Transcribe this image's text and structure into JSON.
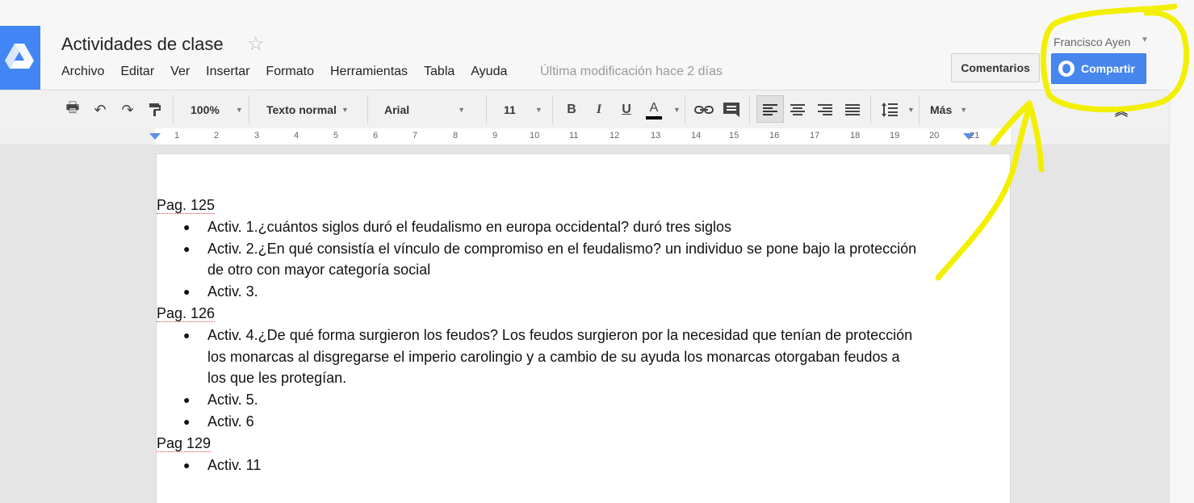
{
  "header": {
    "title": "Actividades de clase",
    "menu": [
      "Archivo",
      "Editar",
      "Ver",
      "Insertar",
      "Formato",
      "Herramientas",
      "Tabla",
      "Ayuda"
    ],
    "last_edit": "Última modificación hace 2 días",
    "user": "Francisco Ayen",
    "comments_label": "Comentarios",
    "share_label": "Compartir"
  },
  "toolbar": {
    "zoom": "100%",
    "style": "Texto normal",
    "font": "Arial",
    "size": "11",
    "bold": "B",
    "italic": "I",
    "underline": "U",
    "text_color": "A",
    "more": "Más"
  },
  "ruler": {
    "marks": [
      "1",
      "2",
      "3",
      "4",
      "5",
      "6",
      "7",
      "8",
      "9",
      "10",
      "11",
      "12",
      "13",
      "14",
      "15",
      "16",
      "17",
      "18",
      "19",
      "20",
      "21"
    ]
  },
  "document": {
    "sections": [
      {
        "heading": "Pag. 125",
        "items": [
          "Activ. 1.¿cuántos siglos duró el feudalismo en europa occidental? duró tres siglos",
          "Activ. 2.¿En qué consistía el vínculo de compromiso en el feudalismo? un individuo se pone bajo la protección de otro con mayor categoría social",
          "Activ. 3."
        ]
      },
      {
        "heading": "Pag. 126",
        "items": [
          "Activ. 4.¿De qué forma surgieron los feudos? Los feudos surgieron por la necesidad que tenían de protección los monarcas al disgregarse el imperio carolingio y a cambio de su ayuda los monarcas otorgaban feudos a los que les protegían.",
          "Activ. 5.",
          "Activ. 6"
        ]
      },
      {
        "heading": "Pag 129",
        "items": [
          "Activ. 11"
        ]
      }
    ]
  },
  "colors": {
    "share_blue": "#4787ed",
    "drive_blue": "#4285f4",
    "annotation_yellow": "#f2f000"
  }
}
